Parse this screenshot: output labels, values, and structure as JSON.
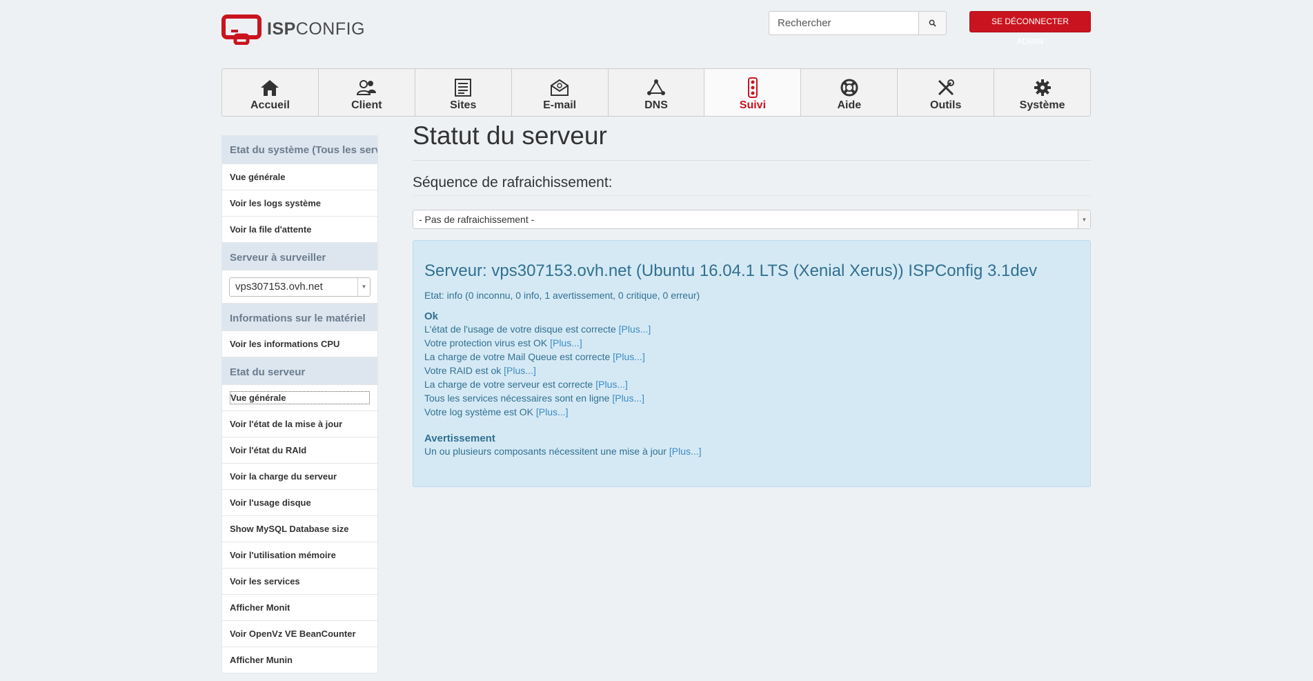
{
  "header": {
    "logo_text_bold": "ISP",
    "logo_text_light": "CONFIG",
    "search_placeholder": "Rechercher",
    "logout_label": "SE DÉCONNECTER ADMIN"
  },
  "nav": [
    {
      "label": "Accueil",
      "icon": "home-icon"
    },
    {
      "label": "Client",
      "icon": "users-icon"
    },
    {
      "label": "Sites",
      "icon": "list-icon"
    },
    {
      "label": "E-mail",
      "icon": "mail-icon"
    },
    {
      "label": "DNS",
      "icon": "network-icon"
    },
    {
      "label": "Suivi",
      "icon": "traffic-light-icon",
      "active": true
    },
    {
      "label": "Aide",
      "icon": "lifebuoy-icon"
    },
    {
      "label": "Outils",
      "icon": "tools-icon"
    },
    {
      "label": "Système",
      "icon": "gear-icon"
    }
  ],
  "sidebar": {
    "section1": {
      "title": "Etat du système (Tous les serveurs)",
      "items": [
        "Vue générale",
        "Voir les logs système",
        "Voir la file d'attente"
      ]
    },
    "section2": {
      "title": "Serveur à surveiller",
      "server_select": "vps307153.ovh.net"
    },
    "section3": {
      "title": "Informations sur le matériel",
      "items": [
        "Voir les informations CPU"
      ]
    },
    "section4": {
      "title": "Etat du serveur",
      "items": [
        "Vue générale",
        "Voir l'état de la mise à jour",
        "Voir l'état du RAId",
        "Voir la charge du serveur",
        "Voir l'usage disque",
        "Show MySQL Database size",
        "Voir l'utilisation mémoire",
        "Voir les services",
        "Afficher Monit",
        "Voir OpenVz VE BeanCounter",
        "Afficher Munin"
      ]
    }
  },
  "content": {
    "title": "Statut du serveur",
    "refresh_label": "Séquence de rafraichissement:",
    "refresh_value": "- Pas de rafraichissement -",
    "server_heading": "Serveur: vps307153.ovh.net (Ubuntu 16.04.1 LTS (Xenial Xerus)) ISPConfig 3.1dev",
    "etat": "Etat: info (0 inconnu, 0 info, 1 avertissement, 0 critique, 0 erreur)",
    "ok_title": "Ok",
    "ok_lines": [
      "L'état de l'usage de votre disque est correcte",
      "Votre protection virus est OK",
      "La charge de votre Mail Queue est correcte",
      "Votre RAID est ok",
      "La charge de votre serveur est correcte",
      "Tous les services nécessaires sont en ligne",
      "Votre log système est OK"
    ],
    "warn_title": "Avertissement",
    "warn_lines": [
      "Un ou plusieurs composants nécessitent une mise à jour"
    ],
    "more_link": "[Plus...]"
  }
}
